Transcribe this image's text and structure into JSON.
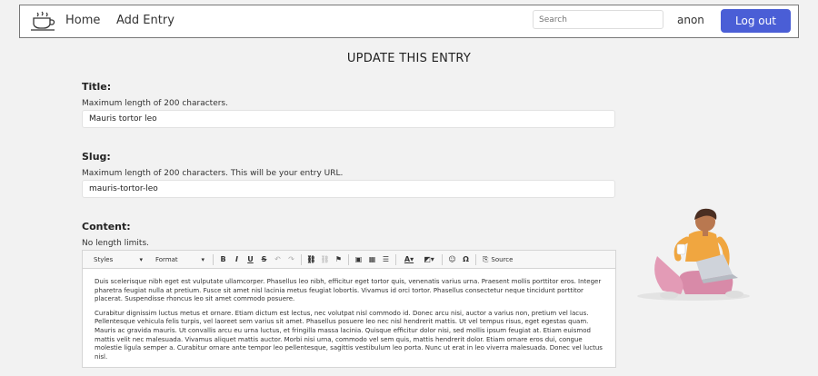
{
  "nav": {
    "home": "Home",
    "add_entry": "Add Entry",
    "search_placeholder": "Search",
    "user": "anon",
    "logout": "Log out"
  },
  "page": {
    "title": "UPDATE THIS ENTRY"
  },
  "form": {
    "title_label": "Title:",
    "title_help": "Maximum length of 200 characters.",
    "title_value": "Mauris tortor leo",
    "slug_label": "Slug:",
    "slug_help": "Maximum length of 200 characters. This will be your entry URL.",
    "slug_value": "mauris-tortor-leo",
    "content_label": "Content:",
    "content_help": "No length limits."
  },
  "editor": {
    "styles": "Styles",
    "format": "Format",
    "source": "Source",
    "paragraphs": [
      "Duis scelerisque nibh eget est vulputate ullamcorper. Phasellus leo nibh, efficitur eget tortor quis, venenatis varius urna. Praesent mollis porttitor eros. Integer pharetra feugiat nulla at pretium. Fusce sit amet nisl lacinia metus feugiat lobortis. Vivamus id orci tortor. Phasellus consectetur neque tincidunt porttitor placerat. Suspendisse rhoncus leo sit amet commodo posuere.",
      "Curabitur dignissim luctus metus et ornare. Etiam dictum est lectus, nec volutpat nisl commodo id. Donec arcu nisi, auctor a varius non, pretium vel lacus. Pellentesque vehicula felis turpis, vel laoreet sem varius sit amet. Phasellus posuere leo nec nisl hendrerit mattis. Ut vel tempus risus, eget egestas quam. Mauris ac gravida mauris. Ut convallis arcu eu urna luctus, et fringilla massa lacinia. Quisque efficitur dolor nisi, sed mollis ipsum feugiat at. Etiam euismod mattis velit nec malesuada. Vivamus aliquet mattis auctor. Morbi nisi urna, commodo vel sem quis, mattis hendrerit dolor. Etiam ornare eros dui, congue molestie ligula semper a. Curabitur ornare ante tempor leo pellentesque, sagittis vestibulum leo porta. Nunc ut erat in leo viverra malesuada. Donec vel luctus nisl."
    ]
  },
  "colors": {
    "accent": "#4a5ed6",
    "background": "#f2f2f2"
  }
}
